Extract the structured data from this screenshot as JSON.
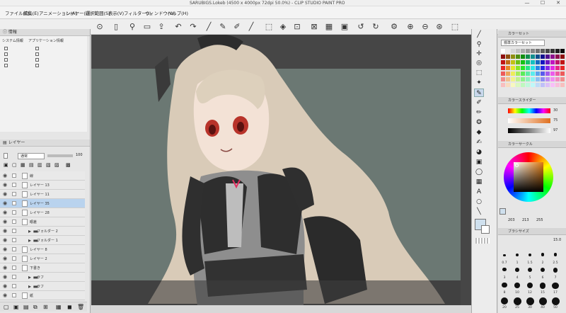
{
  "window": {
    "title": "SARUBIGS.Lokeb (4500 x 4000px 72dpi 50.0%)  - CLIP STUDIO PAINT PRO",
    "min_label": "—",
    "max_label": "☐",
    "close_label": "✕"
  },
  "menu": {
    "items": [
      "ファイル(F)",
      "編集(E)",
      "アニメーション(A)",
      "レイヤー(L)",
      "選択範囲(S)",
      "表示(V)",
      "フィルター(I)",
      "ウィンドウ(W)",
      "ヘルプ(H)"
    ]
  },
  "command_bar": {
    "icons": [
      "clip-studio-icon",
      "new-file-icon",
      "open-icon",
      "save-icon",
      "export-icon",
      "undo-icon",
      "redo-icon",
      "pen-icon",
      "brush-icon",
      "brush2-icon",
      "eraser-icon",
      "select-icon",
      "fill-icon",
      "transform-icon",
      "crop-icon",
      "grid-icon",
      "rotate-left-icon",
      "rotate-right-icon",
      "reset-icon",
      "settings-icon",
      "zoom-in-icon",
      "zoom-out-icon",
      "fit-icon",
      "actual-icon"
    ]
  },
  "info_panel": {
    "title": "情報",
    "col1": "システム情報",
    "col2": "アプリケーション情報"
  },
  "layer_panel": {
    "title": "レイヤー",
    "blend_mode": "通常",
    "opacity": "100",
    "layers": [
      {
        "name": "線",
        "folder": false,
        "selected": false
      },
      {
        "name": "レイヤー 13",
        "folder": false,
        "selected": false
      },
      {
        "name": "レイヤー 11",
        "folder": false,
        "selected": false
      },
      {
        "name": "レイヤー 35",
        "folder": false,
        "selected": true
      },
      {
        "name": "レイヤー 28",
        "folder": false,
        "selected": false
      },
      {
        "name": "眼差",
        "folder": false,
        "selected": false
      },
      {
        "name": "フォルダー 2",
        "folder": true,
        "selected": false
      },
      {
        "name": "フォルダー 1",
        "folder": true,
        "selected": false
      },
      {
        "name": "レイヤー 8",
        "folder": false,
        "selected": false
      },
      {
        "name": "レイヤー 2",
        "folder": false,
        "selected": false
      },
      {
        "name": "下書き",
        "folder": false,
        "selected": false
      },
      {
        "name": "ラフ",
        "folder": true,
        "selected": false
      },
      {
        "name": "ラフ",
        "folder": true,
        "selected": false
      },
      {
        "name": "紙",
        "folder": false,
        "selected": false
      }
    ]
  },
  "right_panel": {
    "color_set_title": "カラーセット",
    "color_set_name": "標準カラーセット",
    "slider_title": "カラースライダー",
    "slider_values": [
      "30",
      "75",
      "97"
    ],
    "wheel_title": "カラーサークル",
    "wheel_values": [
      "203",
      "213",
      "255"
    ],
    "brush_title": "ブラシサイズ",
    "brush_value": "15.0",
    "brush_sizes": [
      "0.7",
      "1",
      "1.5",
      "2",
      "2.5",
      "3",
      "4",
      "5",
      "6",
      "7",
      "8",
      "10",
      "12",
      "15",
      "17",
      "20",
      "25",
      "30",
      "40",
      "50"
    ]
  },
  "colors": {
    "paper": "#6b7873",
    "canvas_bg": "#464646",
    "selected_layer": "#b9d3ee",
    "accent_pink": "#e03060"
  }
}
